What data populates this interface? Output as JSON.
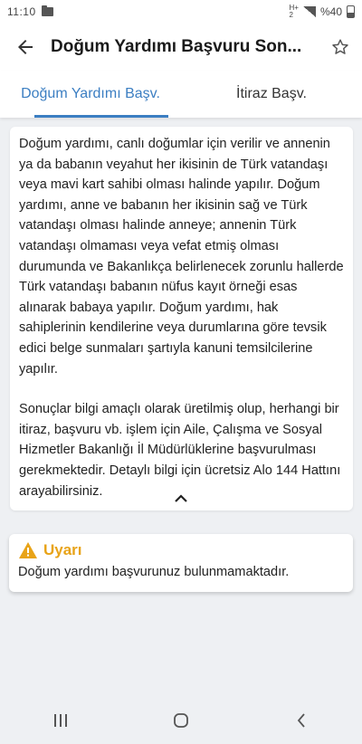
{
  "status_bar": {
    "time": "11:10",
    "network": "H+",
    "network_sub": "2",
    "battery": "%40"
  },
  "app_bar": {
    "title": "Doğum Yardımı Başvuru Son..."
  },
  "tabs": [
    {
      "label": "Doğum Yardımı Başv.",
      "active": true
    },
    {
      "label": "İtiraz Başv.",
      "active": false
    }
  ],
  "info": {
    "paragraph1": "Doğum yardımı, canlı doğumlar için verilir ve annenin ya da babanın veyahut her ikisinin de Türk vatandaşı veya mavi kart sahibi olması halinde yapılır. Doğum yardımı, anne ve babanın her ikisinin sağ ve Türk vatandaşı olması halinde anneye; annenin Türk vatandaşı olmaması veya vefat etmiş olması durumunda ve Bakanlıkça belirlenecek zorunlu hallerde Türk vatandaşı babanın nüfus kayıt örneği esas alınarak babaya yapılır. Doğum yardımı, hak sahiplerinin kendilerine veya durumlarına göre tevsik edici belge sunmaları şartıyla kanuni temsilcilerine yapılır.",
    "paragraph2": "Sonuçlar bilgi amaçlı olarak üretilmiş olup, herhangi bir itiraz, başvuru vb. işlem için Aile, Çalışma ve Sosyal Hizmetler Bakanlığı İl Müdürlüklerine başvurulması gerekmektedir. Detaylı bilgi için ücretsiz Alo 144 Hattını arayabilirsiniz."
  },
  "warning": {
    "title": "Uyarı",
    "message": "Doğum yardımı başvurunuz bulunmamaktadır.",
    "color": "#e8a317"
  },
  "colors": {
    "accent": "#3b7ec2",
    "warning": "#e8a317"
  },
  "icons": {
    "back": "arrow-left-icon",
    "favorite": "star-outline-icon",
    "collapse": "chevron-up-icon",
    "warning": "warning-triangle-icon",
    "nav_recents": "recents-icon",
    "nav_home": "home-icon",
    "nav_back": "nav-back-icon"
  }
}
